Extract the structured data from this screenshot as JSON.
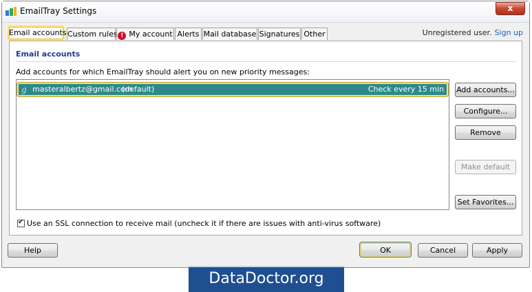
{
  "window": {
    "title": "EmailTray Settings",
    "close_glyph": "x"
  },
  "tabs": [
    {
      "label": "Email accounts",
      "active": true
    },
    {
      "label": "Custom rules"
    },
    {
      "label": "My account",
      "icon": "alert-icon"
    },
    {
      "label": "Alerts"
    },
    {
      "label": "Mail database"
    },
    {
      "label": "Signatures"
    },
    {
      "label": "Other"
    }
  ],
  "account_status": {
    "text": "Unregistered user.",
    "link": "Sign up"
  },
  "section": {
    "title": "Email accounts",
    "description": "Add accounts for which EmailTray should alert you on new priority messages:"
  },
  "accounts": [
    {
      "icon": "g",
      "email": "masteralbertz@gmail.com",
      "tag": "(default)",
      "frequency": "Check every 15 min"
    }
  ],
  "side_buttons": {
    "add": "Add accounts...",
    "configure": "Configure...",
    "remove": "Remove",
    "make_default": "Make default",
    "favorites": "Set Favorites..."
  },
  "ssl_option": {
    "checked": true,
    "label": "Use an SSL connection to receive mail (uncheck it if there are issues with anti-virus software)"
  },
  "footer": {
    "help": "Help",
    "ok": "OK",
    "cancel": "Cancel",
    "apply": "Apply"
  },
  "watermark": "DataDoctor.org",
  "colors": {
    "selection": "#2d8a8a",
    "highlight": "#f2e27a",
    "banner": "#1f4f91",
    "link": "#1a5fb4"
  }
}
